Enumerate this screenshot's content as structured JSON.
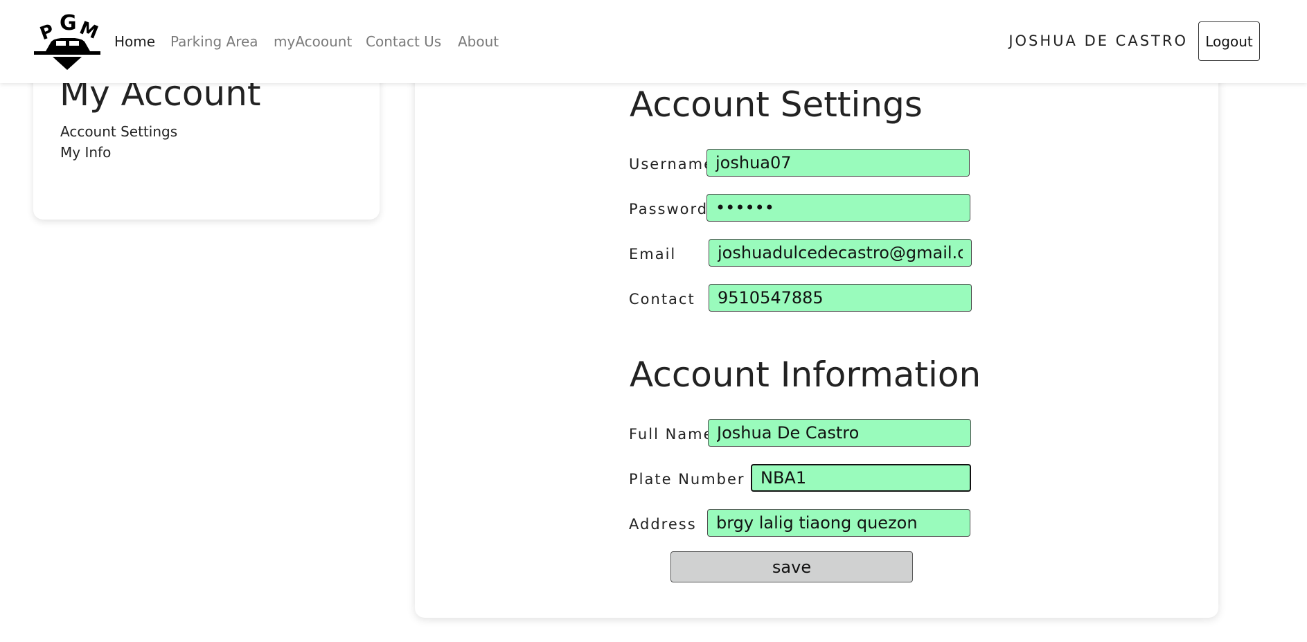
{
  "nav": {
    "logo_icon": "pgm-parking-logo-icon",
    "logo_text": "PGM",
    "links": [
      "Home",
      "Parking Area",
      "myAcoount",
      "Contact Us",
      "About"
    ],
    "user_name": "JOSHUA DE CASTRO",
    "logout_label": "Logout"
  },
  "sidebar": {
    "title": "My Account",
    "links": [
      "Account Settings",
      "My Info"
    ]
  },
  "account_settings": {
    "title": "Account Settings",
    "username_label": "Username",
    "username_value": "joshua07",
    "password_label": "Password",
    "password_value": "••••••",
    "email_label": "Email",
    "email_value": "joshuadulcedecastro@gmail.com",
    "contact_label": "Contact",
    "contact_value": "9510547885"
  },
  "account_information": {
    "title": "Account Information",
    "fullname_label": "Full Name",
    "fullname_value": "Joshua De Castro",
    "plate_label": "Plate Number",
    "plate_value": "NBA1",
    "address_label": "Address",
    "address_value": "brgy lalig tiaong quezon"
  },
  "save_label": "save",
  "colors": {
    "input_background": "#99fbbc",
    "save_button": "#d0d1d1",
    "active_nav": "#1d1d1d",
    "inactive_nav": "#7a7a7a"
  }
}
